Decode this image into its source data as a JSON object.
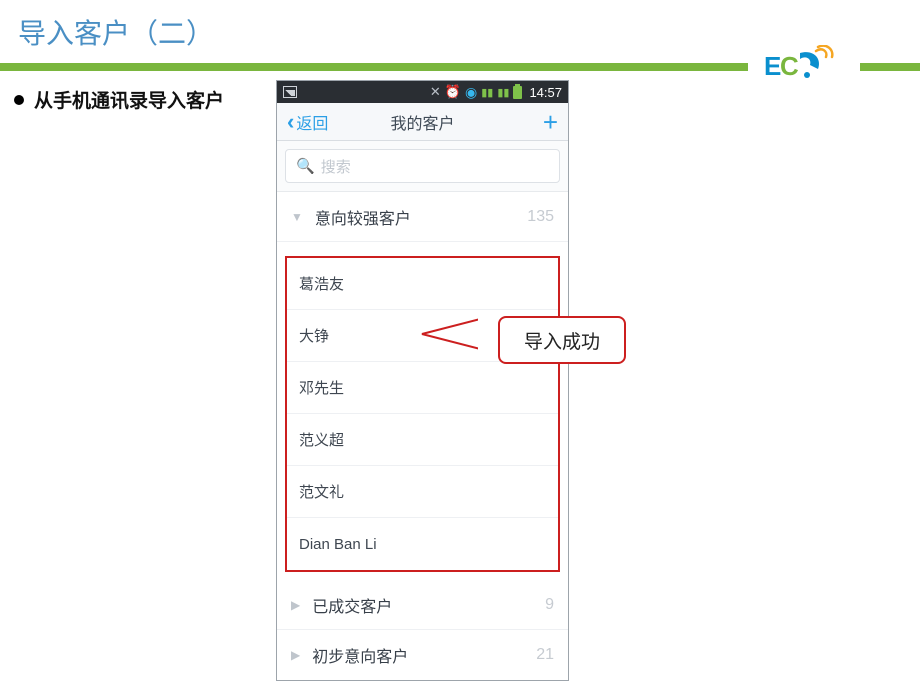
{
  "slide": {
    "title": "导入客户（二）"
  },
  "bullet": {
    "text": "从手机通讯录导入客户"
  },
  "logo": {
    "text1": "E",
    "text2": "C"
  },
  "status": {
    "time": "14:57"
  },
  "nav": {
    "back": "返回",
    "title": "我的客户"
  },
  "search": {
    "placeholder": "搜索"
  },
  "groups": {
    "expanded": {
      "name": "意向较强客户",
      "count": "135"
    },
    "collapsed1": {
      "name": "已成交客户",
      "count": "9"
    },
    "collapsed2": {
      "name": "初步意向客户",
      "count": "21"
    }
  },
  "contacts": [
    "葛浩友",
    "大铮",
    "邓先生",
    "范义超",
    "范文礼",
    "Dian Ban Li"
  ],
  "callout": {
    "text": "导入成功"
  }
}
